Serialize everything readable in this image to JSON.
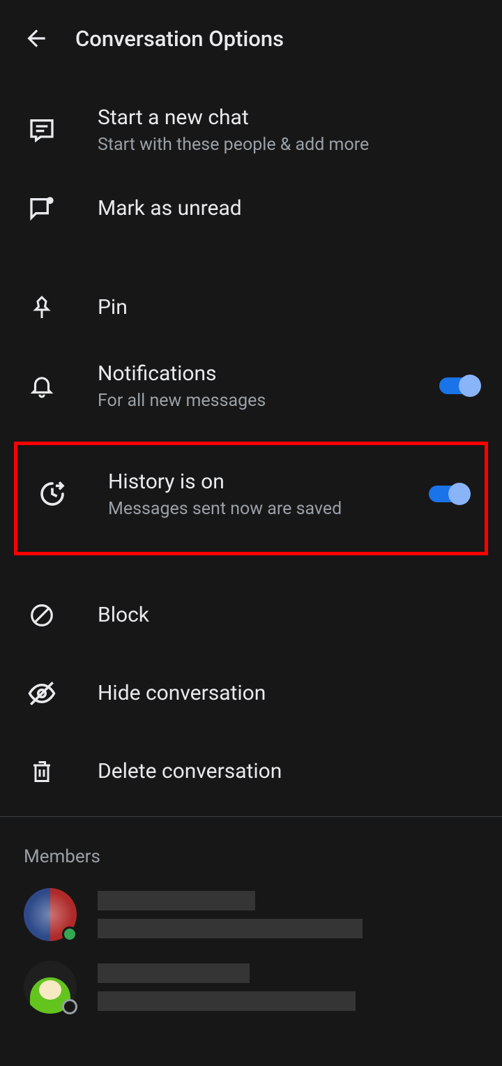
{
  "header": {
    "title": "Conversation Options"
  },
  "options": {
    "newChat": {
      "title": "Start a new chat",
      "sub": "Start with these people & add more"
    },
    "markUnread": {
      "title": "Mark as unread"
    },
    "pin": {
      "title": "Pin"
    },
    "notifications": {
      "title": "Notifications",
      "sub": "For all new messages",
      "enabled": true
    },
    "history": {
      "title": "History is on",
      "sub": "Messages sent now are saved",
      "enabled": true
    },
    "block": {
      "title": "Block"
    },
    "hide": {
      "title": "Hide conversation"
    },
    "delete": {
      "title": "Delete conversation"
    }
  },
  "membersHeader": "Members",
  "members": [
    {
      "presence": "online"
    },
    {
      "presence": "offline"
    }
  ]
}
